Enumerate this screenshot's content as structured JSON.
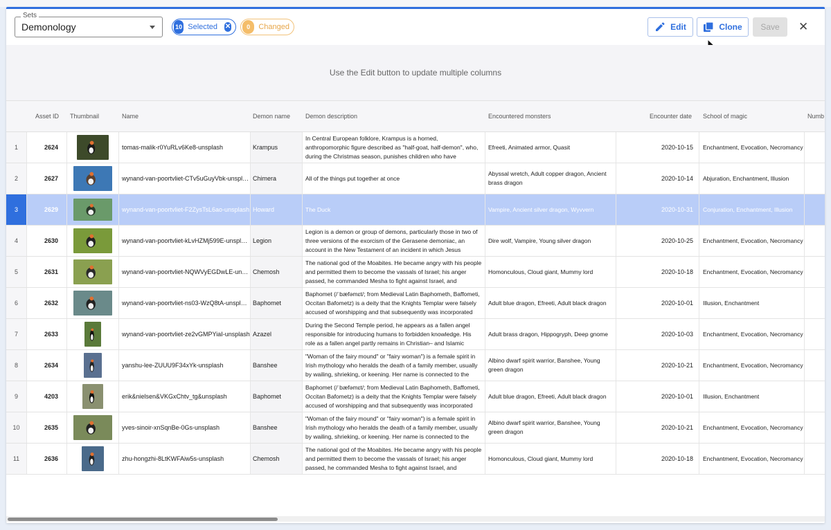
{
  "toolbar": {
    "sets_label": "Sets",
    "sets_value": "Demonology",
    "selected_count": "10",
    "selected_label": "Selected",
    "changed_count": "0",
    "changed_label": "Changed",
    "edit_label": "Edit",
    "clone_label": "Clone",
    "save_label": "Save",
    "close_glyph": "✕"
  },
  "hint": "Use the Edit button to update multiple columns",
  "columns": {
    "asset_id": "Asset ID",
    "thumbnail": "Thumbnail",
    "name": "Name",
    "demon_name": "Demon name",
    "demon_description": "Demon description",
    "encountered_monsters": "Encountered monsters",
    "encounter_date": "Encounter date",
    "school_of_magic": "School of magic",
    "number": "Numb"
  },
  "rows": [
    {
      "num": "1",
      "id": "2624",
      "name": "tomas-malik-r0YuRLv6Ke8-unsplash",
      "demon": "Krampus",
      "desc": "In Central European folklore, Krampus is a horned, anthropomorphic figure described as \"half-goat, half-demon\", who, during the Christmas season, punishes children who have misbehaved, in contrast with Saint Nicholas, who rewards the",
      "monsters": "Efreeti, Animated armor, Quasit",
      "date": "2020-10-15",
      "school": "Enchantment, Evocation, Necromancy"
    },
    {
      "num": "2",
      "id": "2627",
      "name": "wynand-van-poortvliet-CTv5uGuyVbk-unsplas...",
      "demon": "Chimera",
      "desc": "All of the things put together at once",
      "monsters": "Abyssal wretch, Adult copper dragon, Ancient brass dragon",
      "date": "2020-10-14",
      "school": "Abjuration, Enchantment, Illusion"
    },
    {
      "num": "3",
      "id": "2629",
      "name": "wynand-van-poortvliet-F2ZysTsL6ao-unsplash",
      "demon": "Howard",
      "desc": "The Duck",
      "monsters": "Vampire, Ancient silver dragon, Wyvvern",
      "date": "2020-10-31",
      "school": "Conjuration, Enchantment, Illusion"
    },
    {
      "num": "4",
      "id": "2630",
      "name": "wynand-van-poortvliet-kLvHZMj599E-unsplas...",
      "demon": "Legion",
      "desc": "Legion is a demon or group of demons, particularly those in two of three versions of the exorcism of the Gerasene demoniac, an account in the New Testament of an incident in which Jesus performs an exorcism.",
      "monsters": "Dire wolf, Vampire, Young silver dragon",
      "date": "2020-10-25",
      "school": "Enchantment, Evocation, Necromancy"
    },
    {
      "num": "5",
      "id": "2631",
      "name": "wynand-van-poortvliet-NQWVyEGDwLE-unspl...",
      "demon": "Chemosh",
      "desc": "The national god of the Moabites. He became angry with his people and permitted them to become the vassals of Israel; his anger passed, he commanded Mesha to fight against Israel, and Moabitish independence was reestablished (Moabite Stone",
      "monsters": "Homonculous, Cloud giant, Mummy lord",
      "date": "2020-10-18",
      "school": "Enchantment, Evocation, Necromancy"
    },
    {
      "num": "6",
      "id": "2632",
      "name": "wynand-van-poortvliet-ns03-WzQ8tA-unsplas...",
      "demon": "Baphomet",
      "desc": "Baphomet (/ˈbæfəmɛt/; from Medieval Latin Baphometh, Baffometi, Occitan Bafometz) is a deity that the Knights Templar were falsely accused of worshipping and that subsequently was incorporated into disparate occult and",
      "monsters": "Adult blue dragon, Efreeti, Adult black dragon",
      "date": "2020-10-01",
      "school": "Illusion, Enchantment"
    },
    {
      "num": "7",
      "id": "2633",
      "name": "wynand-van-poortvliet-ze2vGMPYiaI-unsplash",
      "demon": "Azazel",
      "desc": "During the Second Temple period, he appears as a fallen angel responsible for introducing humans to forbidden knowledge. His role as a fallen angel partly remains in Christian– and Islamic traditions. In Islam, he is often, but not exclusively,",
      "monsters": "Adult brass dragon, Hippogryph, Deep gnome",
      "date": "2020-10-03",
      "school": "Enchantment, Evocation, Necromancy"
    },
    {
      "num": "8",
      "id": "2634",
      "name": "yanshu-lee-ZUUU9F34xYk-unsplash",
      "demon": "Banshee",
      "desc": "\"Woman of the fairy mound\" or \"fairy woman\") is a female spirit in Irish mythology who heralds the death of a family member, usually by wailing, shrieking, or keening. Her name is connected to the mythologically important tumuli or \"mounds\"",
      "monsters": "Albino dwarf spirit warrior, Banshee, Young green dragon",
      "date": "2020-10-21",
      "school": "Enchantment, Evocation, Necromancy"
    },
    {
      "num": "9",
      "id": "4203",
      "name": "erik&nielsen&VKGxChtv_tg&unsplash",
      "demon": "Baphomet",
      "desc": "Baphomet (/ˈbæfəmɛt/; from Medieval Latin Baphometh, Baffometi, Occitan Bafometz) is a deity that the Knights Templar were falsely accused of worshipping and that subsequently was incorporated into disparate occult and",
      "monsters": "Adult blue dragon, Efreeti, Adult black dragon",
      "date": "2020-10-01",
      "school": "Illusion, Enchantment"
    },
    {
      "num": "10",
      "id": "2635",
      "name": "yves-sinoir-xnSqnBe-0Gs-unsplash",
      "demon": "Banshee",
      "desc": "\"Woman of the fairy mound\" or \"fairy woman\") is a female spirit in Irish mythology who heralds the death of a family member, usually by wailing, shrieking, or keening. Her name is connected to the mythologically important tumuli or \"mounds\"",
      "monsters": "Albino dwarf spirit warrior, Banshee, Young green dragon",
      "date": "2020-10-21",
      "school": "Enchantment, Evocation, Necromancy"
    },
    {
      "num": "11",
      "id": "2636",
      "name": "zhu-hongzhi-8LtKWFAiw5s-unsplash",
      "demon": "Chemosh",
      "desc": "The national god of the Moabites. He became angry with his people and permitted them to become the vassals of Israel; his anger passed, he commanded Mesha to fight against Israel, and Moabitish independence was reestablished (Moabite Stone",
      "monsters": "Homonculous, Cloud giant, Mummy lord",
      "date": "2020-10-18",
      "school": "Enchantment, Evocation, Necromancy"
    }
  ],
  "colors": {
    "accent": "#2f6fde",
    "selected_row": "#b9cdf8",
    "changed_chip": "#f4bd6a"
  },
  "icons": [
    "pencil-icon",
    "copy-icon",
    "close-icon",
    "chevron-down-icon",
    "mouse-pointer-icon"
  ]
}
